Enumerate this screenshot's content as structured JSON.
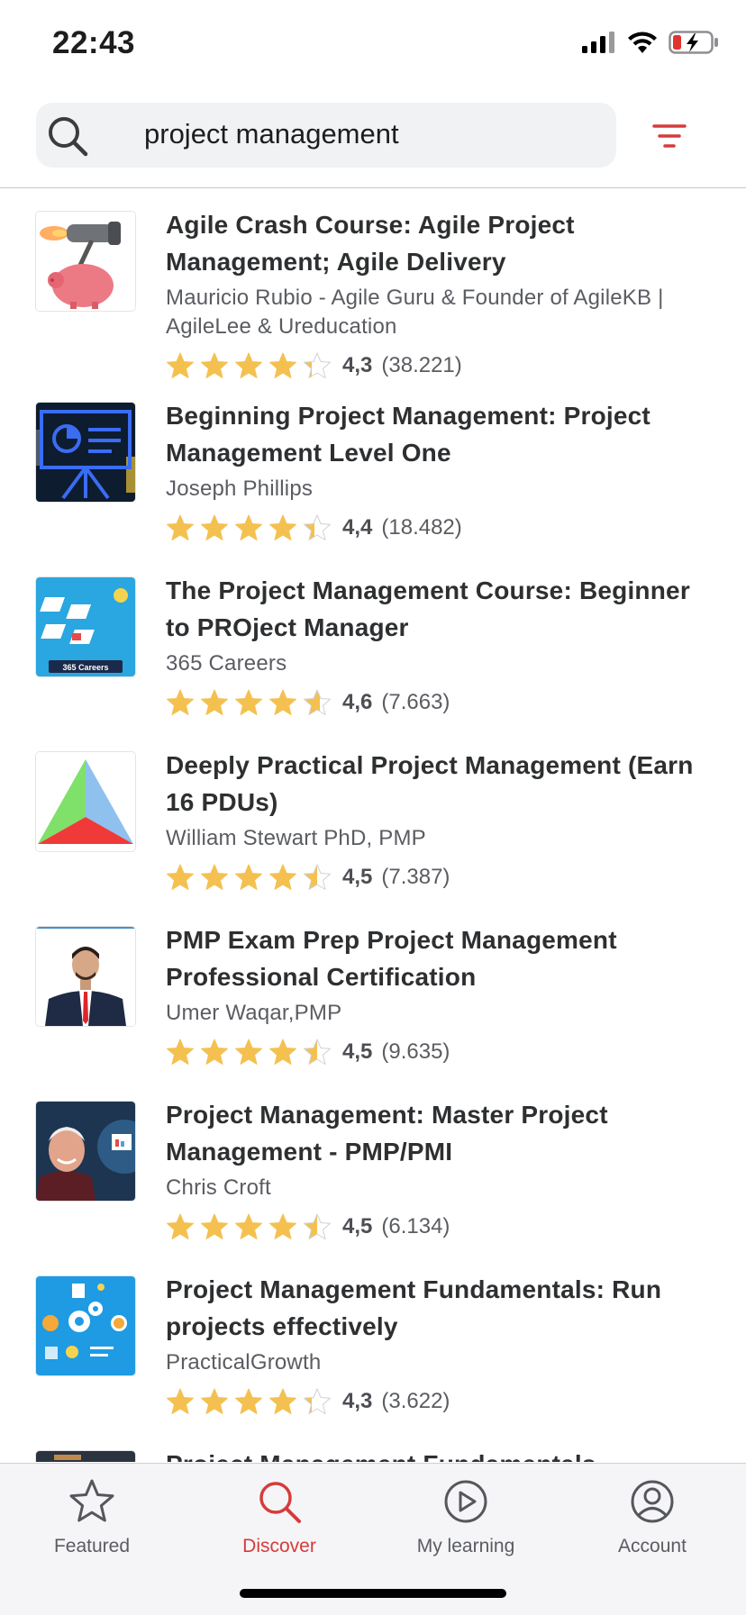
{
  "status_bar": {
    "time": "22:43"
  },
  "search": {
    "query": "project management",
    "icon": "search-icon",
    "filter_icon": "filter-icon"
  },
  "colors": {
    "accent": "#d63b3b",
    "star": "#f4c150",
    "star_empty": "#d1d1d1",
    "tab_bg": "#f5f5f7"
  },
  "courses": [
    {
      "title": "Agile Crash Course: Agile Project Management; Agile Delivery",
      "author": "Mauricio Rubio - Agile Guru & Founder of AgileKB | AgileLee & Ureducation",
      "rating": "4,3",
      "reviews": "(38.221)",
      "stars": 4.3
    },
    {
      "title": "Beginning Project Management: Project Management Level One",
      "author": "Joseph Phillips",
      "rating": "4,4",
      "reviews": "(18.482)",
      "stars": 4.4
    },
    {
      "title": "The Project Management Course: Beginner to PROject Manager",
      "author": "365 Careers",
      "rating": "4,6",
      "reviews": "(7.663)",
      "stars": 4.6,
      "thumb_label": "365 Careers"
    },
    {
      "title": "Deeply Practical Project Management (Earn 16 PDUs)",
      "author": "William Stewart PhD, PMP",
      "rating": "4,5",
      "reviews": "(7.387)",
      "stars": 4.5
    },
    {
      "title": "PMP Exam Prep Project Management Professional Certification",
      "author": "Umer Waqar,PMP",
      "rating": "4,5",
      "reviews": "(9.635)",
      "stars": 4.5
    },
    {
      "title": "Project Management: Master Project Management - PMP/PMI",
      "author": "Chris Croft",
      "rating": "4,5",
      "reviews": "(6.134)",
      "stars": 4.5
    },
    {
      "title": "Project Management Fundamentals: Run projects effectively",
      "author": "PracticalGrowth",
      "rating": "4,3",
      "reviews": "(3.622)",
      "stars": 4.3
    },
    {
      "title": "Project Management Fundamentals"
    }
  ],
  "tab_bar": {
    "tabs": [
      {
        "label": "Featured",
        "icon": "star-icon",
        "active": false
      },
      {
        "label": "Discover",
        "icon": "search-icon",
        "active": true
      },
      {
        "label": "My learning",
        "icon": "play-circle-icon",
        "active": false
      },
      {
        "label": "Account",
        "icon": "account-icon",
        "active": false
      }
    ]
  }
}
